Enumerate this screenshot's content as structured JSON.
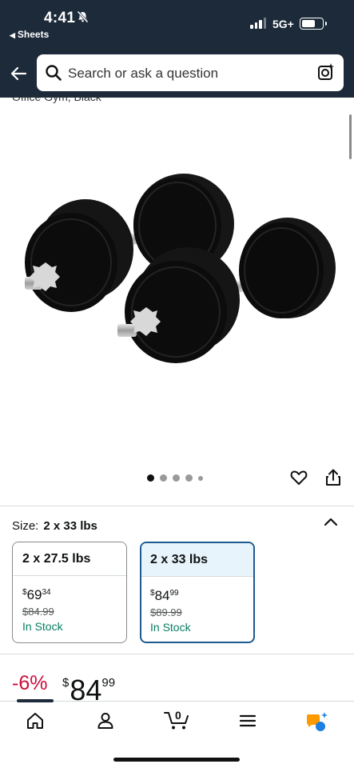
{
  "status_bar": {
    "time": "4:41",
    "back_app": "Sheets",
    "network": "5G+"
  },
  "search": {
    "placeholder": "Search or ask a question"
  },
  "product": {
    "title_partial": "Office Gym, Black"
  },
  "carousel": {
    "total_dots": 5,
    "active_index": 0
  },
  "size": {
    "label": "Size:",
    "selected": "2 x 33 lbs",
    "options": [
      {
        "name": "2 x 27.5 lbs",
        "price_whole": "69",
        "price_fraction": "34",
        "currency": "$",
        "list_price": "$84.99",
        "availability": "In Stock"
      },
      {
        "name": "2 x 33 lbs",
        "price_whole": "84",
        "price_fraction": "99",
        "currency": "$",
        "list_price": "$89.99",
        "availability": "In Stock"
      }
    ]
  },
  "price": {
    "discount": "-6%",
    "currency": "$",
    "whole": "84",
    "fraction": "99"
  },
  "cart": {
    "count": "0"
  },
  "colors": {
    "header_bg": "#1c2a39",
    "discount_red": "#cc0c39",
    "stock_green": "#067d62",
    "selected_border": "#1d5a8f"
  }
}
